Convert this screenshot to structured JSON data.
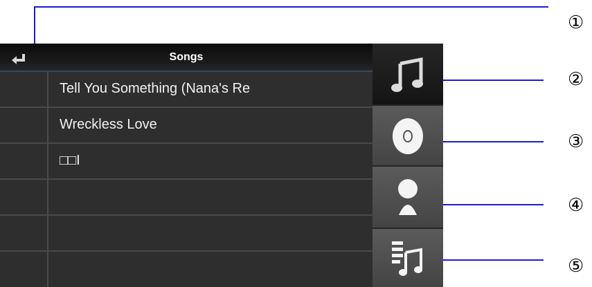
{
  "header": {
    "title": "Songs",
    "back_icon": "return-arrow-icon"
  },
  "songs": [
    {
      "title": "Tell You Something (Nana's Re"
    },
    {
      "title": "Wreckless Love"
    },
    {
      "title": "□□I"
    },
    {
      "title": ""
    },
    {
      "title": ""
    },
    {
      "title": ""
    }
  ],
  "sidebar": {
    "tabs": [
      {
        "icon": "music-note-icon",
        "active": true
      },
      {
        "icon": "disc-icon",
        "active": false
      },
      {
        "icon": "person-icon",
        "active": false
      },
      {
        "icon": "playlist-icon",
        "active": false
      }
    ]
  },
  "callouts": [
    "①",
    "②",
    "③",
    "④",
    "⑤"
  ],
  "colors": {
    "callout_line": "#1b1bd6",
    "list_bg": "#2e2e2e",
    "active_tab": "#1c1c1c"
  }
}
